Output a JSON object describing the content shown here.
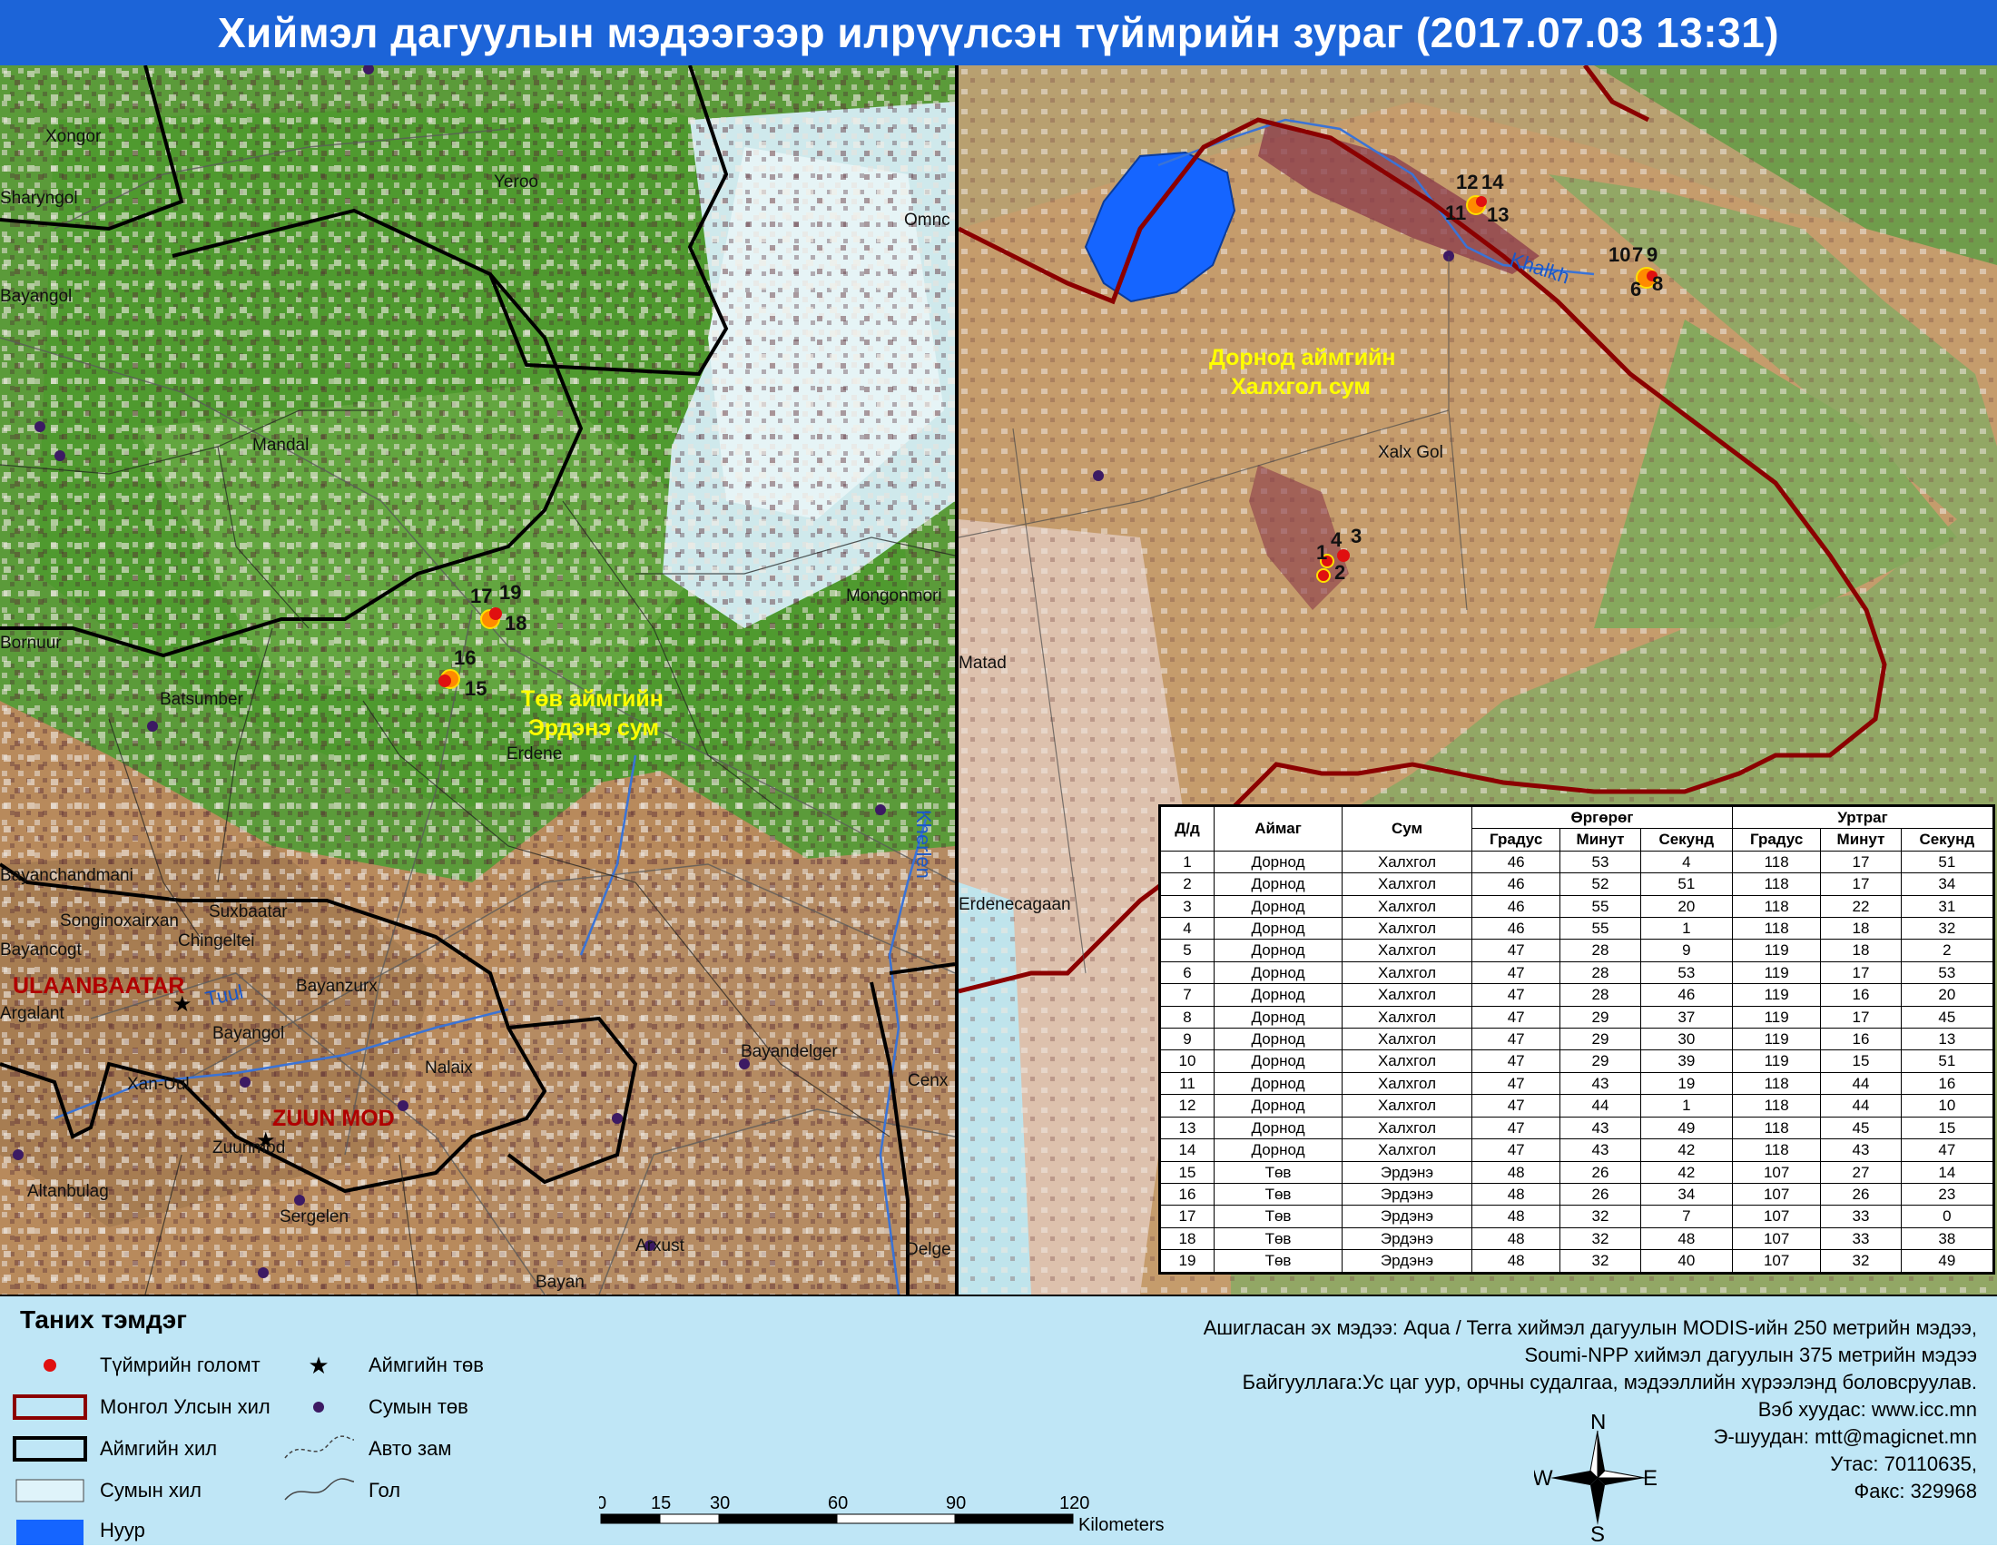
{
  "title": "Хиймэл дагуулын мэдээгээр илрүүлсэн түймрийн зураг  (2017.07.03  13:31)",
  "left_map": {
    "places": [
      "Xongor",
      "Sharyngol",
      "Yeroo",
      "Omnc",
      "Bayangol",
      "Mandal",
      "Bornuur",
      "Batsumber",
      "Mongonmori",
      "Erdene",
      "Bayanchandmani",
      "Songinoxairxan",
      "Suxbaatar",
      "Chingeltei",
      "Bayancogt",
      "Bayanzurx",
      "Argalant",
      "Bayangol",
      "Xan-Uul",
      "Nalaix",
      "Bayandelger",
      "Cenx",
      "Zuunmod",
      "Altanbulag",
      "Sergelen",
      "Arxust",
      "Delge",
      "Bayan"
    ],
    "cities": [
      "ULAANBAATAR",
      "ZUUN MOD"
    ],
    "rivers": [
      "Tuul",
      "Kherlen"
    ],
    "region_label_line1": "Төв аймгийн",
    "region_label_line2": "Эрдэнэ сум",
    "fire_labels": [
      "17",
      "19",
      "18",
      "16",
      "15"
    ]
  },
  "right_map": {
    "places": [
      "Xalx Gol",
      "Matad",
      "Erdenecagaan"
    ],
    "rivers": [
      "Khalkh"
    ],
    "region_label_line1": "Дорнод аймгийн",
    "region_label_line2": "Халхгол сум",
    "fire_labels": [
      "12",
      "14",
      "11",
      "13",
      "10",
      "7",
      "9",
      "6",
      "8",
      "1",
      "4",
      "3",
      "2"
    ]
  },
  "table": {
    "headers": {
      "no": "Д/д",
      "aimag": "Аймаг",
      "sum": "Сум",
      "lat": "Өргөрөг",
      "lon": "Уртраг",
      "deg": "Градус",
      "min": "Минут",
      "sec": "Секунд"
    },
    "rows": [
      [
        "1",
        "Дорнод",
        "Халхгол",
        "46",
        "53",
        "4",
        "118",
        "17",
        "51"
      ],
      [
        "2",
        "Дорнод",
        "Халхгол",
        "46",
        "52",
        "51",
        "118",
        "17",
        "34"
      ],
      [
        "3",
        "Дорнод",
        "Халхгол",
        "46",
        "55",
        "20",
        "118",
        "22",
        "31"
      ],
      [
        "4",
        "Дорнод",
        "Халхгол",
        "46",
        "55",
        "1",
        "118",
        "18",
        "32"
      ],
      [
        "5",
        "Дорнод",
        "Халхгол",
        "47",
        "28",
        "9",
        "119",
        "18",
        "2"
      ],
      [
        "6",
        "Дорнод",
        "Халхгол",
        "47",
        "28",
        "53",
        "119",
        "17",
        "53"
      ],
      [
        "7",
        "Дорнод",
        "Халхгол",
        "47",
        "28",
        "46",
        "119",
        "16",
        "20"
      ],
      [
        "8",
        "Дорнод",
        "Халхгол",
        "47",
        "29",
        "37",
        "119",
        "17",
        "45"
      ],
      [
        "9",
        "Дорнод",
        "Халхгол",
        "47",
        "29",
        "30",
        "119",
        "16",
        "13"
      ],
      [
        "10",
        "Дорнод",
        "Халхгол",
        "47",
        "29",
        "39",
        "119",
        "15",
        "51"
      ],
      [
        "11",
        "Дорнод",
        "Халхгол",
        "47",
        "43",
        "19",
        "118",
        "44",
        "16"
      ],
      [
        "12",
        "Дорнод",
        "Халхгол",
        "47",
        "44",
        "1",
        "118",
        "44",
        "10"
      ],
      [
        "13",
        "Дорнод",
        "Халхгол",
        "47",
        "43",
        "49",
        "118",
        "45",
        "15"
      ],
      [
        "14",
        "Дорнод",
        "Халхгол",
        "47",
        "43",
        "42",
        "118",
        "43",
        "47"
      ],
      [
        "15",
        "Төв",
        "Эрдэнэ",
        "48",
        "26",
        "42",
        "107",
        "27",
        "14"
      ],
      [
        "16",
        "Төв",
        "Эрдэнэ",
        "48",
        "26",
        "34",
        "107",
        "26",
        "23"
      ],
      [
        "17",
        "Төв",
        "Эрдэнэ",
        "48",
        "32",
        "7",
        "107",
        "33",
        "0"
      ],
      [
        "18",
        "Төв",
        "Эрдэнэ",
        "48",
        "32",
        "48",
        "107",
        "33",
        "38"
      ],
      [
        "19",
        "Төв",
        "Эрдэнэ",
        "48",
        "32",
        "40",
        "107",
        "32",
        "49"
      ]
    ]
  },
  "legend": {
    "title": "Таних тэмдэг",
    "items": {
      "fire": "Түймрийн голомт",
      "aimag_center": "Аймгийн төв",
      "country_border": "Монгол Улсын хил",
      "sum_center": "Сумын төв",
      "aimag_border": "Аймгийн хил",
      "road": "Авто зам",
      "sum_border": "Сумын хил",
      "river": "Гол",
      "lake": "Нуур"
    }
  },
  "source": {
    "line1": "Ашигласан эх мэдээ: Aqua / Terra хиймэл дагуулын MODIS-ийн 250 метрийн мэдээ,",
    "line2": "Soumi-NPP хиймэл дагуулын 375 метрийн мэдээ",
    "line3": "Байгууллага:Ус цаг уур, орчны судалгаа, мэдээллийн хүрээлэнд боловсруулав.",
    "line4": "Вэб хуудас: www.icc.mn",
    "line5": "Э-шуудан: mtt@magicnet.mn",
    "line6": "Утас: 70110635,",
    "line7": "Факс: 329968"
  },
  "scale": {
    "ticks": [
      "0",
      "15",
      "30",
      "60",
      "90",
      "120"
    ],
    "unit": "Kilometers"
  },
  "compass": {
    "n": "N",
    "s": "S",
    "e": "E",
    "w": "W"
  },
  "colors": {
    "title_bg": "#1c64d8",
    "fire": "#e01010",
    "country_border": "#8b0000",
    "lake": "#1565ff",
    "legend_bg": "#bfe6f6"
  }
}
